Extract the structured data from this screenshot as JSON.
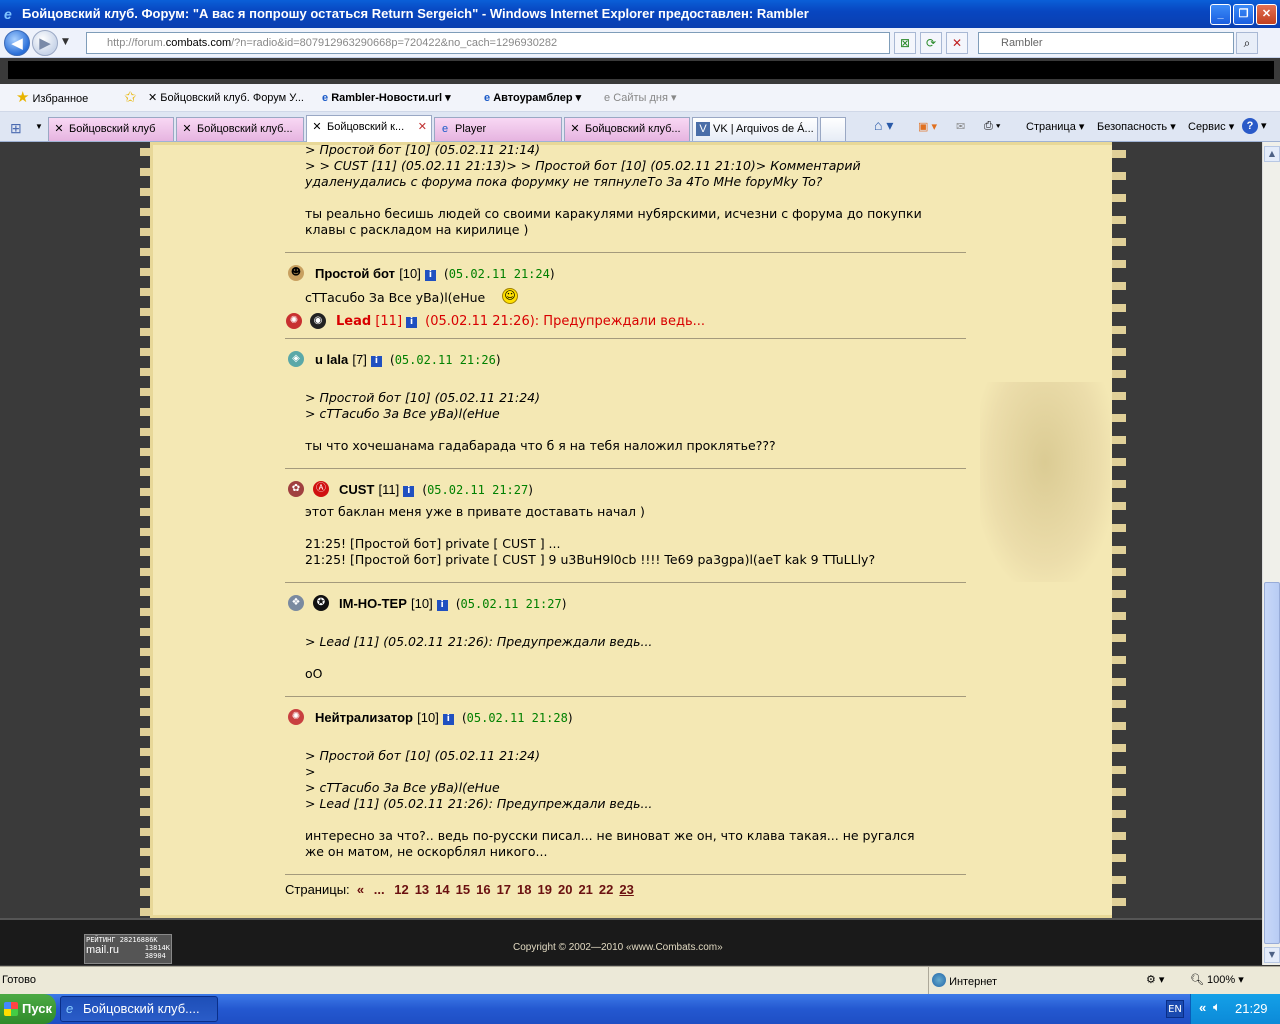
{
  "window": {
    "title": "Бойцовский клуб. Форум: \"А вас я попрошу остаться Return Sergeich\" - Windows Internet Explorer предоставлен: Rambler"
  },
  "address": {
    "prefix": "http://forum.",
    "domain": "combats.com",
    "path": "/?n=radio&id=807912963290668p=720422&no_cach=1296930282",
    "search_placeholder": "Rambler"
  },
  "favbar": {
    "favorites": "Избранное",
    "items": [
      "Бойцовский клуб. Форум У...",
      "Rambler-Новости.url",
      "Автоурамблер",
      "Сайты дня"
    ]
  },
  "tabs": [
    "Бойцовский клуб",
    "Бойцовский клуб...",
    "Бойцовский к...",
    "Player",
    "Бойцовский клуб...",
    "VK | Arquivos de Á..."
  ],
  "toolbar": {
    "page": "Страница",
    "security": "Безопасность",
    "service": "Сервис"
  },
  "top_quote": [
    "> Простой бот [10] (05.02.11 21:14)",
    "> > CUST [11] (05.02.11 21:13)> > Простой бот [10] (05.02.11 21:10)> Комментарий",
    "удаленудались с форума пока форумку не тяпнулеТо За 4То МНе fopyMky To?"
  ],
  "top_text": [
    "ты реально бесишь людей со своими каракулями нубярскими, исчезни с форума до покупки",
    "клавы с раскладом на кирилице )"
  ],
  "posts": [
    {
      "nick": "Простой бот",
      "level": "[10]",
      "date": "05.02.11 21:24",
      "paren_open": "(",
      "paren_close": ")",
      "body": [
        "сТТасuбо За Все уВа)l(eHue"
      ]
    },
    {
      "nick": "u lala",
      "level": "[7]",
      "date": "05.02.11 21:26",
      "paren_open": "(",
      "paren_close": ")",
      "quote": [
        ">  Простой бот [10] (05.02.11 21:24)",
        "> сТТасuбо За Все уВа)l(eHue"
      ],
      "body": [
        "ты что хочешанама гадабарада что б я на тебя наложил проклятье???"
      ]
    },
    {
      "nick": "CUST",
      "level": "[11]",
      "date": "05.02.11 21:27",
      "paren_open": "(",
      "paren_close": ")",
      "body": [
        "этот баклан меня уже в привате доставать начал )",
        "",
        "21:25! [Простой бот] private [ CUST ] ...",
        "21:25! [Простой бот] private [ CUST ] 9 u3BuH9l0cb !!!! Te69 pa3gpa)l(aeT kak 9 TTuLLly?"
      ]
    },
    {
      "nick": "IM-HO-TEP",
      "level": "[10]",
      "date": "05.02.11 21:27",
      "paren_open": "(",
      "paren_close": ")",
      "quote": [
        "> Lead [11] (05.02.11 21:26): Предупреждали ведь..."
      ],
      "body": [
        "oO"
      ]
    },
    {
      "nick": "Нейтрализатор",
      "level": "[10]",
      "date": "05.02.11 21:28",
      "paren_open": "(",
      "paren_close": ")",
      "quote": [
        "> Простой бот [10] (05.02.11 21:24)",
        ">",
        "> сТТасuбо За Все уВа)l(eHue",
        "> Lead [11] (05.02.11 21:26): Предупреждали ведь..."
      ],
      "body": [
        "интересно за что?.. ведь по-русски писал... не виноват же он, что клава такая... не ругался",
        "же он матом, не оскорблял никого..."
      ]
    }
  ],
  "lead": {
    "nick": "Lead",
    "level": "[11]",
    "text": "(05.02.11 21:26): Предупреждали ведь..."
  },
  "pages": {
    "label": "Страницы:",
    "prev": "«",
    "dots": "...",
    "numbers": [
      "12",
      "13",
      "14",
      "15",
      "16",
      "17",
      "18",
      "19",
      "20",
      "21",
      "22",
      "23"
    ],
    "current": "23"
  },
  "footer": {
    "copyright": "Copyright © 2002—2010 «www.Combats.com»",
    "rating_line1": "РЕЙТИНГ 28216886К",
    "rating_logo": "mail.ru",
    "rating_n1": "13814K",
    "rating_n2": "38904"
  },
  "status": {
    "text": "Готово",
    "zone": "Интернет",
    "zoom": "100%"
  },
  "taskbar": {
    "start": "Пуск",
    "task": "Бойцовский клуб....",
    "lang": "EN",
    "time": "21:29"
  }
}
